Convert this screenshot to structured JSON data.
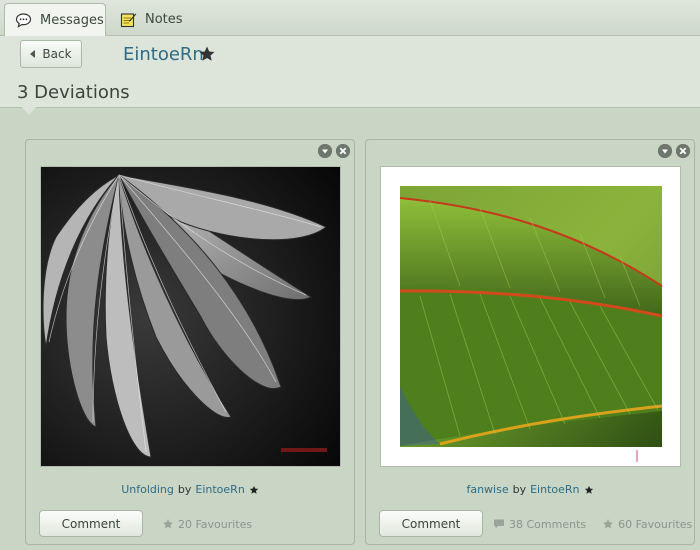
{
  "tabs": [
    {
      "label": "Messages",
      "icon": "speech-bubble-icon",
      "active": true
    },
    {
      "label": "Notes",
      "icon": "notepad-icon",
      "active": false
    }
  ],
  "header": {
    "back_label": "Back",
    "username": "EintoeRn"
  },
  "section": {
    "title": "3 Deviations"
  },
  "deviations": [
    {
      "title": "Unfolding",
      "by": "by",
      "author": "EintoeRn",
      "comment_label": "Comment",
      "comments": "",
      "favourites": "20 Favourites"
    },
    {
      "title": "fanwise",
      "by": "by",
      "author": "EintoeRn",
      "comment_label": "Comment",
      "comments": "38 Comments",
      "favourites": "60 Favourites"
    }
  ],
  "colors": {
    "link": "#2f6b84",
    "background": "#c9d6c6",
    "header_bg": "#dde5da",
    "muted_text": "#8a968a"
  }
}
